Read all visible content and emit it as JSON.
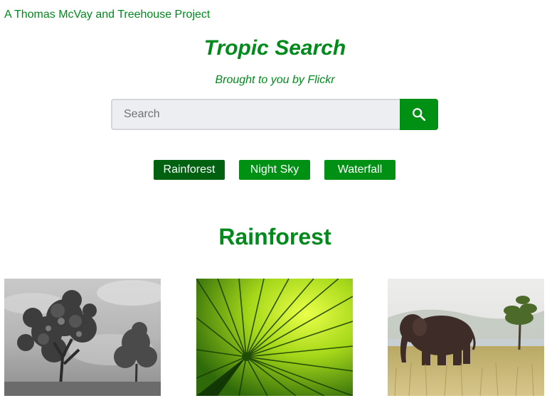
{
  "header": {
    "credit": "A Thomas McVay and Treehouse Project",
    "title": "Tropic Search",
    "subtitle": "Brought to you by Flickr"
  },
  "search": {
    "placeholder": "Search",
    "value": "",
    "button_icon": "search-icon"
  },
  "nav": {
    "items": [
      {
        "label": "Rainforest",
        "active": true
      },
      {
        "label": "Night Sky",
        "active": false
      },
      {
        "label": "Waterfall",
        "active": false
      }
    ]
  },
  "results": {
    "title": "Rainforest",
    "photos": [
      {
        "subject": "black-and-white-tree"
      },
      {
        "subject": "green-palm-leaf"
      },
      {
        "subject": "elephant-in-grassland"
      }
    ]
  },
  "colors": {
    "accent": "#008a1c",
    "button": "#009114",
    "button_active": "#006110"
  }
}
